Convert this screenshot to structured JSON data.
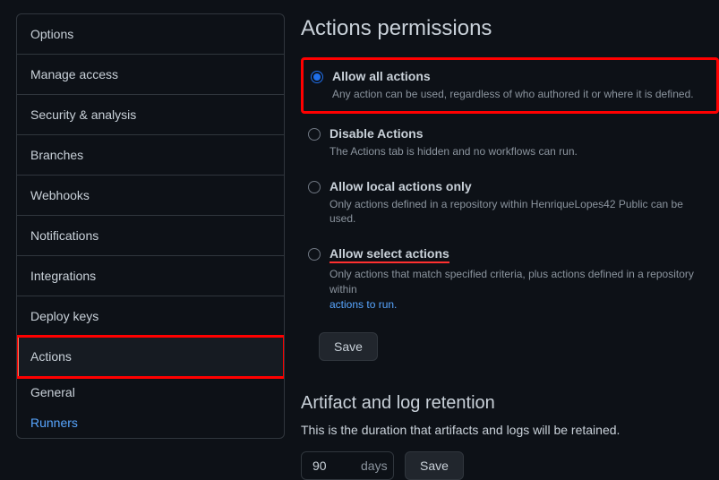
{
  "sidebar": {
    "items": [
      {
        "label": "Options"
      },
      {
        "label": "Manage access"
      },
      {
        "label": "Security & analysis"
      },
      {
        "label": "Branches"
      },
      {
        "label": "Webhooks"
      },
      {
        "label": "Notifications"
      },
      {
        "label": "Integrations"
      },
      {
        "label": "Deploy keys"
      },
      {
        "label": "Actions"
      }
    ],
    "sub": {
      "general": "General",
      "runners": "Runners"
    }
  },
  "main": {
    "title": "Actions permissions",
    "options": [
      {
        "label": "Allow all actions",
        "desc": "Any action can be used, regardless of who authored it or where it is defined."
      },
      {
        "label": "Disable Actions",
        "desc": "The Actions tab is hidden and no workflows can run."
      },
      {
        "label": "Allow local actions only",
        "desc": "Only actions defined in a repository within HenriqueLopes42 Public can be used."
      },
      {
        "label": "Allow select actions",
        "desc_prefix": "Only actions that match specified criteria, plus actions defined in a repository within ",
        "desc_link": "actions to run."
      }
    ],
    "save": "Save"
  },
  "artifact": {
    "title": "Artifact and log retention",
    "desc": "This is the duration that artifacts and logs will be retained.",
    "value": "90",
    "unit": "days",
    "save": "Save"
  }
}
